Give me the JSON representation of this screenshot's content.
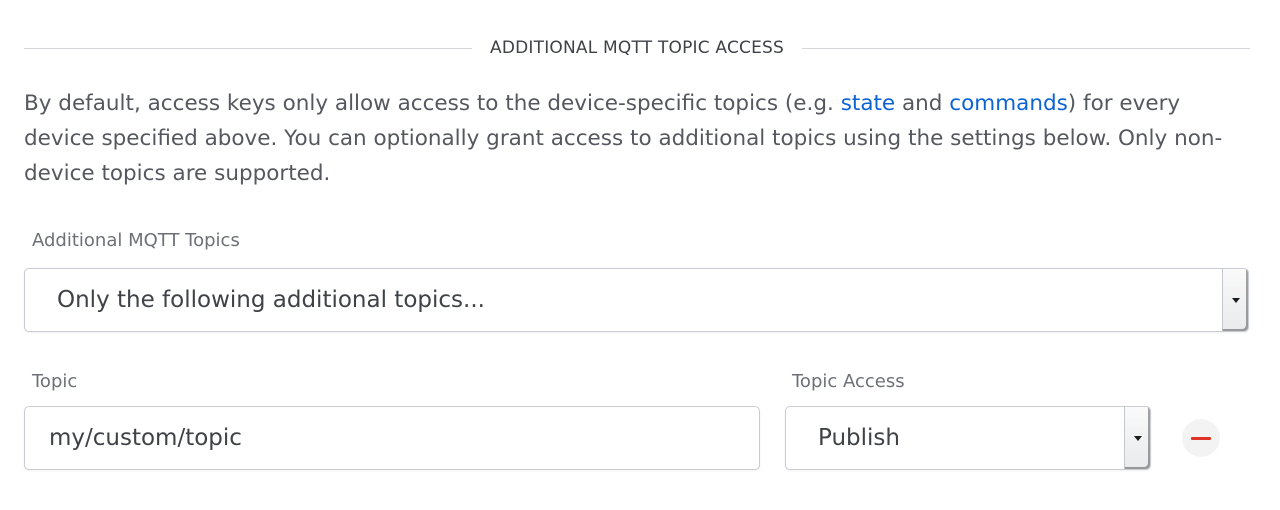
{
  "section": {
    "title": "ADDITIONAL MQTT TOPIC ACCESS"
  },
  "description": {
    "part1": "By default, access keys only allow access to the device-specific topics (e.g. ",
    "link_state": "state",
    "part2": " and ",
    "link_commands": "commands",
    "part3": ") for every device specified above. You can optionally grant access to additional topics using the settings below. Only non-device topics are supported."
  },
  "additional_topics": {
    "label": "Additional MQTT Topics",
    "selected": "Only the following additional topics..."
  },
  "topic_row": {
    "topic_label": "Topic",
    "topic_value": "my/custom/topic",
    "access_label": "Topic Access",
    "access_selected": "Publish",
    "remove_icon": "minus-icon",
    "remove_color": "#e0342b"
  },
  "colors": {
    "link": "#0b63d6",
    "text": "#55585e"
  }
}
